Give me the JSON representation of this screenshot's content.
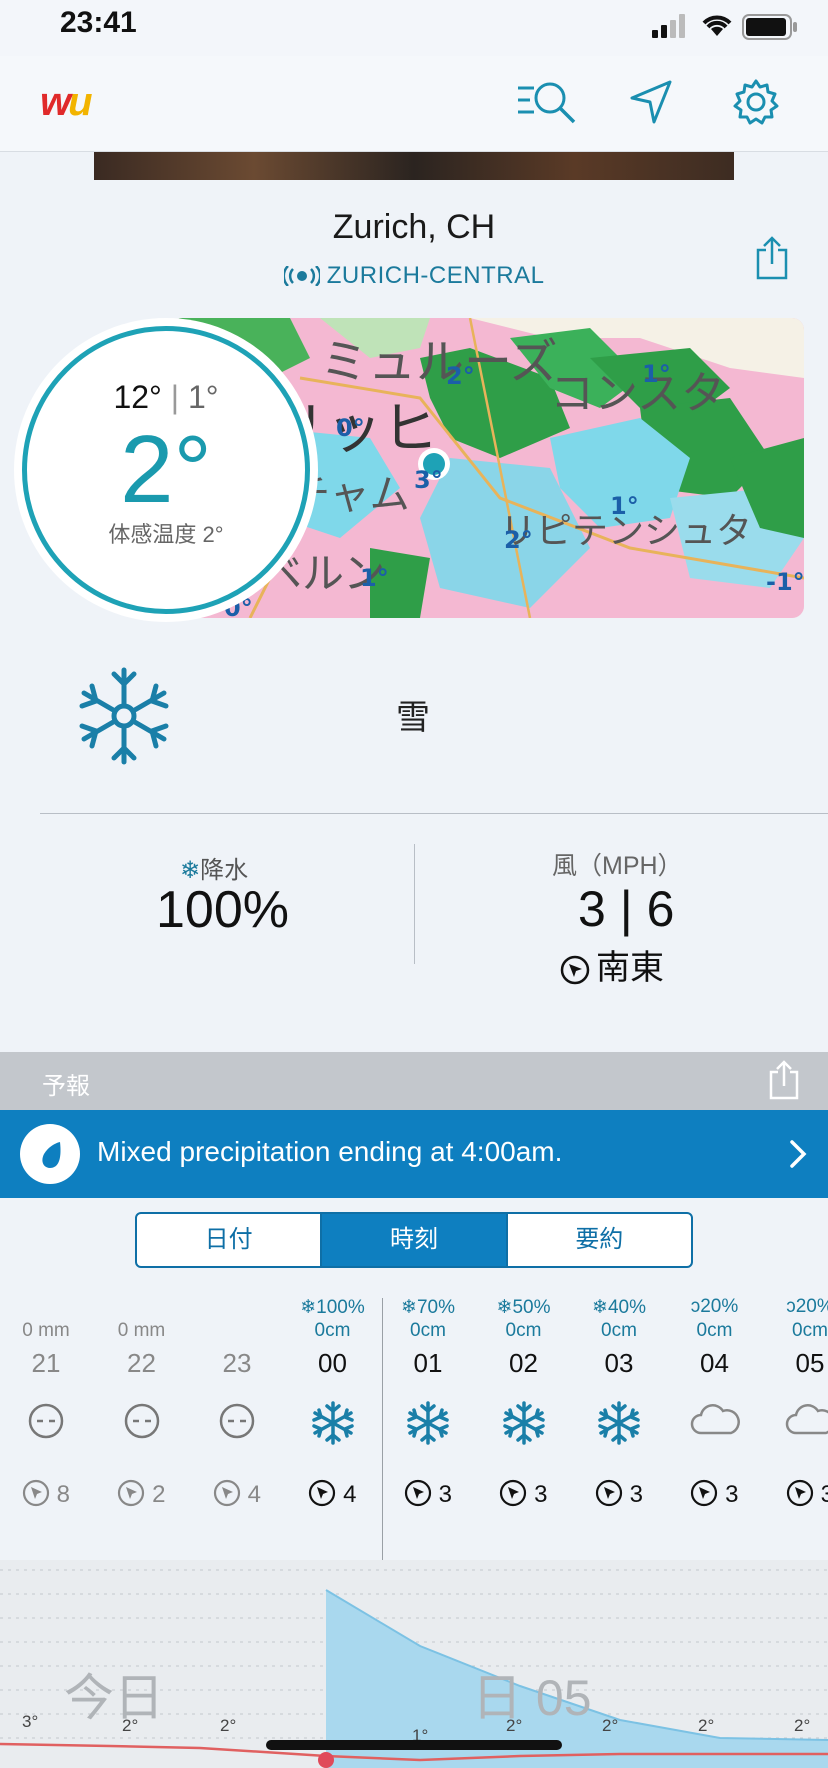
{
  "status": {
    "time": "23:41"
  },
  "header": {
    "logo": "wu"
  },
  "location": {
    "title": "Zurich, CH",
    "station": "ZURICH-CENTRAL"
  },
  "map": {
    "place_labels": [
      "ミュルーズ",
      "コンスタ",
      "リッヒ",
      "チャム",
      "リピテンシュタ",
      "ベルン"
    ],
    "temp_labels": [
      "2°",
      "1°",
      "0°",
      "3°",
      "1°",
      "2°",
      "1°",
      "-1°",
      "0°"
    ]
  },
  "current": {
    "high": "12°",
    "low": "1°",
    "temp": "2°",
    "feels_like": "体感温度 2°"
  },
  "condition": {
    "text": "雪",
    "icon": "snowflake-icon"
  },
  "precip": {
    "label": "降水",
    "value": "100%"
  },
  "wind": {
    "label": "風（MPH）",
    "value": "3 | 6",
    "direction": "南東"
  },
  "forecast": {
    "label": "予報"
  },
  "alert": {
    "text": "Mixed precipitation ending at 4:00am."
  },
  "tabs": [
    {
      "label": "日付",
      "active": false
    },
    {
      "label": "時刻",
      "active": true
    },
    {
      "label": "要約",
      "active": false
    }
  ],
  "hourly": [
    {
      "pp": "",
      "amt": "0 mm",
      "hour": "21",
      "icon": "cloud-face-icon",
      "wind": "8",
      "past": true
    },
    {
      "pp": "",
      "amt": "0 mm",
      "hour": "22",
      "icon": "cloud-face-icon",
      "wind": "2",
      "past": true
    },
    {
      "pp": "",
      "amt": "",
      "hour": "23",
      "icon": "cloud-face-icon",
      "wind": "4",
      "past": true
    },
    {
      "pp": "100%",
      "amt": "0cm",
      "hour": "00",
      "icon": "snowflake-icon",
      "wind": "4",
      "past": false
    },
    {
      "pp": "70%",
      "amt": "0cm",
      "hour": "01",
      "icon": "snowflake-icon",
      "wind": "3",
      "past": false
    },
    {
      "pp": "50%",
      "amt": "0cm",
      "hour": "02",
      "icon": "snowflake-icon",
      "wind": "3",
      "past": false
    },
    {
      "pp": "40%",
      "amt": "0cm",
      "hour": "03",
      "icon": "snowflake-icon",
      "wind": "3",
      "past": false
    },
    {
      "pp": "20%",
      "amt": "0cm",
      "hour": "04",
      "icon": "cloud-icon",
      "wind": "3",
      "past": false
    },
    {
      "pp": "20%",
      "amt": "0cm",
      "hour": "05",
      "icon": "cloud-icon",
      "wind": "3",
      "past": false
    }
  ],
  "chart": {
    "day_labels": [
      "今日",
      "日 05"
    ],
    "temp_labels": [
      "3°",
      "2°",
      "2°",
      "1°",
      "2°",
      "2°",
      "2°",
      "2°"
    ]
  }
}
